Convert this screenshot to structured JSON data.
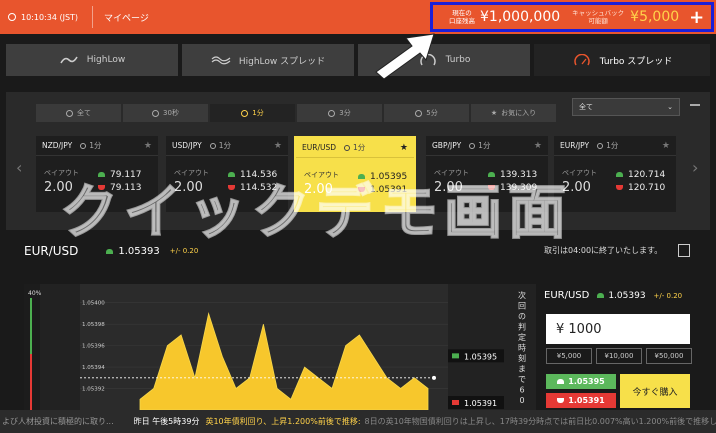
{
  "topbar": {
    "time": "10:10:34 (JST)",
    "mypage": "マイページ",
    "balance_label_1": "現在の",
    "balance_label_2": "口座残高",
    "balance": "¥1,000,000",
    "cashback_label_1": "キャッシュバック",
    "cashback_label_2": "可能額",
    "cashback": "¥5,000",
    "plus": "+"
  },
  "tabs": [
    {
      "label": "HighLow"
    },
    {
      "label": "HighLow スプレッド"
    },
    {
      "label": "Turbo"
    },
    {
      "label": "Turbo スプレッド"
    }
  ],
  "periods": [
    "全て",
    "30秒",
    "1分",
    "3分",
    "5分",
    "お気に入り"
  ],
  "filter": {
    "value": "全て"
  },
  "cards": [
    {
      "pair": "NZD/JPY",
      "period": "1分",
      "payout_label": "ペイアウト",
      "payout": "2.00",
      "high": "79.117",
      "low": "79.113"
    },
    {
      "pair": "USD/JPY",
      "period": "1分",
      "payout_label": "ペイアウト",
      "payout": "2.00",
      "high": "114.536",
      "low": "114.532"
    },
    {
      "pair": "EUR/USD",
      "period": "1分",
      "payout_label": "ペイアウト",
      "payout": "2.00",
      "high": "1.05395",
      "low": "1.05391"
    },
    {
      "pair": "GBP/JPY",
      "period": "1分",
      "payout_label": "ペイアウト",
      "payout": "2.00",
      "high": "139.313",
      "low": "139.309"
    },
    {
      "pair": "EUR/JPY",
      "period": "1分",
      "payout_label": "ペイアウト",
      "payout": "2.00",
      "high": "120.714",
      "low": "120.710"
    }
  ],
  "watermark": "クイックデモ画面",
  "quote": {
    "pair": "EUR/USD",
    "price": "1.05393",
    "change": "+/- 0.20",
    "note": "取引は04:00に終了いたします。"
  },
  "chart": {
    "pct_label": "40%",
    "y_ticks": [
      "1.05400",
      "1.05398",
      "1.05396",
      "1.05394",
      "1.05392"
    ],
    "high_tag": "1.05395",
    "low_tag": "1.05391",
    "countdown_label": "次回の判定時刻まで60"
  },
  "chart_data": {
    "type": "area",
    "ylim": [
      1.0539,
      1.05401
    ],
    "values": [
      1.05391,
      1.05392,
      1.05396,
      1.05397,
      1.05393,
      1.05399,
      1.05395,
      1.05392,
      1.05393,
      1.05398,
      1.05392,
      1.05391,
      1.05394,
      1.05393,
      1.05392,
      1.05396,
      1.05397,
      1.05395,
      1.05393,
      1.05392,
      1.05393,
      1.05392
    ]
  },
  "trade": {
    "pair": "EUR/USD",
    "price": "1.05393",
    "change": "+/- 0.20",
    "amount": "¥ 1000",
    "quick": [
      "¥5,000",
      "¥10,000",
      "¥50,000"
    ],
    "high": "1.05395",
    "low": "1.05391",
    "buy": "今すぐ購入"
  },
  "ticker": {
    "a": "よび人材投資に積極的に取り...",
    "time": "昨日 午後5時39分",
    "highlight": "英10年債利回り、上昇1.200%前後で推移:",
    "b": "8日の英10年物国債利回りは上昇し、17時39分時点では前日比0.007%高い1.200%前後で推移し..."
  },
  "colors": {
    "brand": "#e8552d",
    "accent": "#f7e04a",
    "high": "#5cb85c",
    "low": "#e53935",
    "highlight_box": "#1b1fd8"
  }
}
